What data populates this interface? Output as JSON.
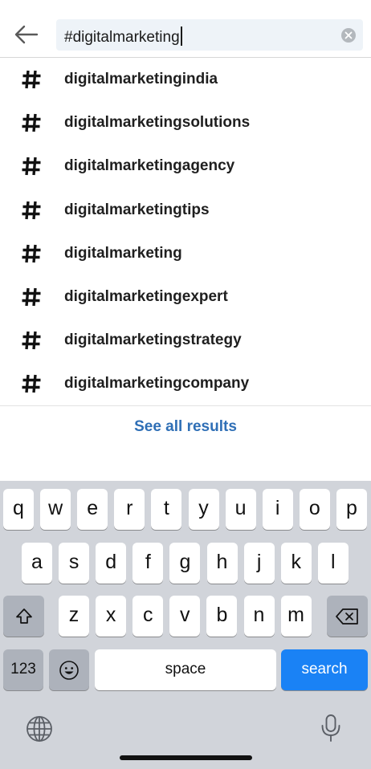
{
  "search": {
    "query": "#digitalmarketing"
  },
  "suggestions": [
    {
      "label": "digitalmarketingindia"
    },
    {
      "label": "digitalmarketingsolutions"
    },
    {
      "label": "digitalmarketingagency"
    },
    {
      "label": "digitalmarketingtips"
    },
    {
      "label": "digitalmarketing"
    },
    {
      "label": "digitalmarketingexpert"
    },
    {
      "label": "digitalmarketingstrategy"
    },
    {
      "label": "digitalmarketingcompany"
    }
  ],
  "see_all_label": "See all results",
  "keyboard": {
    "row1": [
      "q",
      "w",
      "e",
      "r",
      "t",
      "y",
      "u",
      "i",
      "o",
      "p"
    ],
    "row2": [
      "a",
      "s",
      "d",
      "f",
      "g",
      "h",
      "j",
      "k",
      "l"
    ],
    "row3": [
      "z",
      "x",
      "c",
      "v",
      "b",
      "n",
      "m"
    ],
    "numbers_label": "123",
    "space_label": "space",
    "search_label": "search",
    "icons": {
      "shift": "shift-icon",
      "delete": "backspace-icon",
      "emoji": "emoji-icon",
      "globe": "globe-icon",
      "mic": "microphone-icon"
    }
  },
  "colors": {
    "link": "#2f6fb6",
    "search_key": "#1a82f5",
    "keyboard_bg": "#d1d4da",
    "search_field_bg": "#eef3f8"
  }
}
